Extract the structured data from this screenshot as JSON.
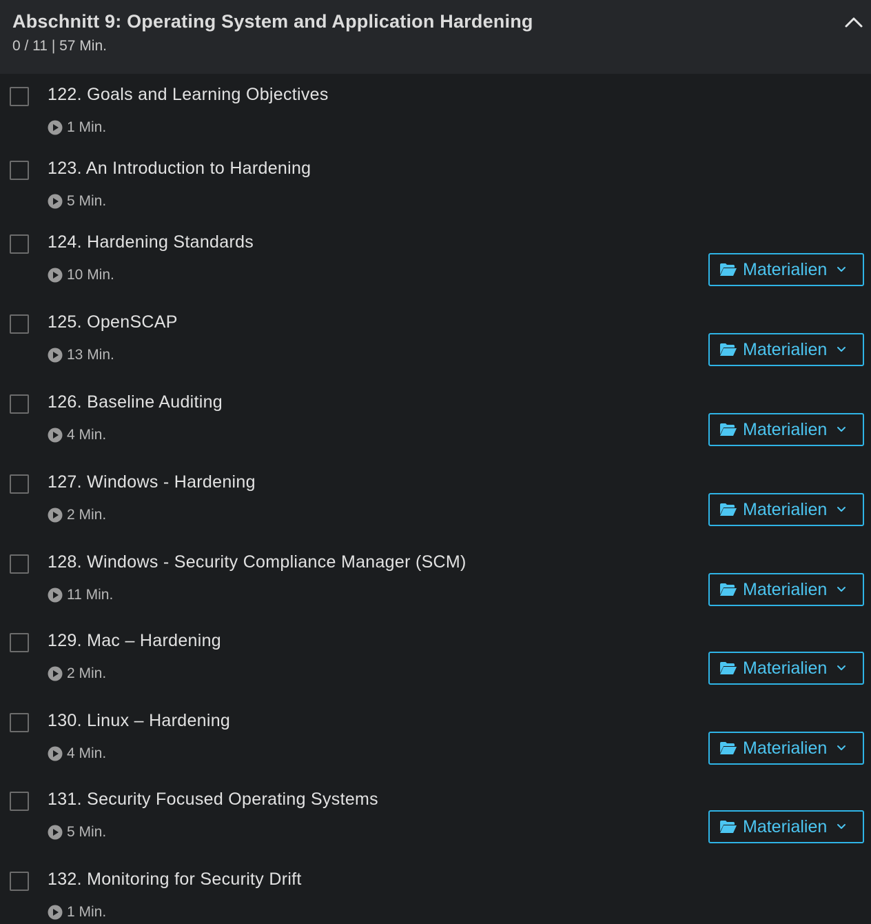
{
  "section": {
    "title": "Abschnitt 9: Operating System and Application Hardening",
    "meta": "0 / 11 | 57 Min.",
    "collapse_icon": "chevron-up-icon"
  },
  "materials_label": "Materialien",
  "colors": {
    "background": "#1b1d1f",
    "header_background": "#25272a",
    "accent": "#2fb4e6"
  },
  "items": [
    {
      "title": "122. Goals and Learning Objectives",
      "duration": "1 Min.",
      "has_materials": false
    },
    {
      "title": "123. An Introduction to Hardening",
      "duration": "5 Min.",
      "has_materials": false
    },
    {
      "title": "124. Hardening Standards",
      "duration": "10 Min.",
      "has_materials": true
    },
    {
      "title": "125. OpenSCAP",
      "duration": "13 Min.",
      "has_materials": true
    },
    {
      "title": "126. Baseline Auditing",
      "duration": "4 Min.",
      "has_materials": true
    },
    {
      "title": "127. Windows - Hardening",
      "duration": "2 Min.",
      "has_materials": true
    },
    {
      "title": "128. Windows - Security Compliance Manager (SCM)",
      "duration": "11 Min.",
      "has_materials": true
    },
    {
      "title": "129. Mac – Hardening",
      "duration": "2 Min.",
      "has_materials": true
    },
    {
      "title": "130. Linux – Hardening",
      "duration": "4 Min.",
      "has_materials": true
    },
    {
      "title": "131. Security Focused Operating Systems",
      "duration": "5 Min.",
      "has_materials": true
    },
    {
      "title": "132. Monitoring for Security Drift",
      "duration": "1 Min.",
      "has_materials": false
    }
  ]
}
